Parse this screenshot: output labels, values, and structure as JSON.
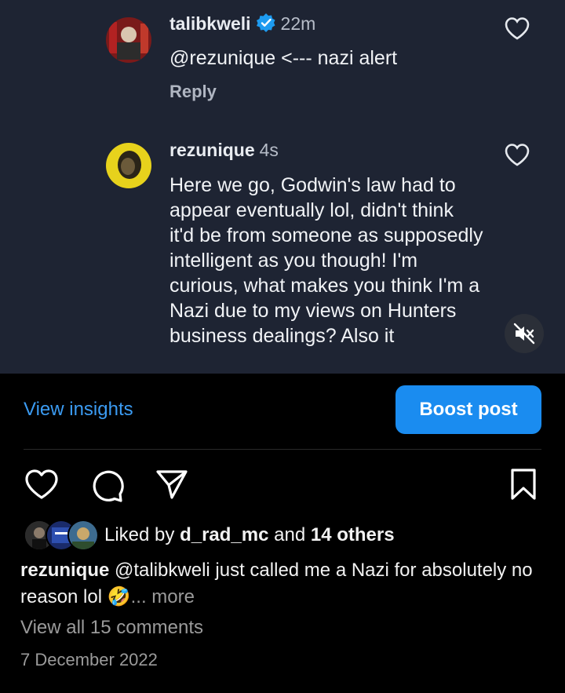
{
  "comments": [
    {
      "username": "talibkweli",
      "time": "22m",
      "text": "@rezunique <--- nazi alert",
      "reply_label": "Reply",
      "verified": true
    },
    {
      "username": "rezunique",
      "time": "4s",
      "text": "Here we go, Godwin's law had to appear eventually lol, didn't think it'd be from someone as supposedly intelligent as you though! I'm curious, what makes you think I'm a Nazi due to my views on Hunters business dealings? Also it"
    }
  ],
  "post_actions": {
    "insights_label": "View insights",
    "boost_label": "Boost post"
  },
  "likes": {
    "prefix": "Liked by",
    "user": "d_rad_mc",
    "connector": "and",
    "others": "14 others"
  },
  "caption": {
    "username": "rezunique",
    "text": "@talibkweli just called me a Nazi for absolutely no reason lol",
    "emoji": "🤣",
    "more_label": "... more"
  },
  "view_all_comments": "View all 15 comments",
  "date": "7 December 2022",
  "colors": {
    "accent_blue": "#1a8cf0",
    "link_blue": "#3b9bf2",
    "verified_blue": "#1d9bf0",
    "screenshot_bg": "#1e2433"
  }
}
